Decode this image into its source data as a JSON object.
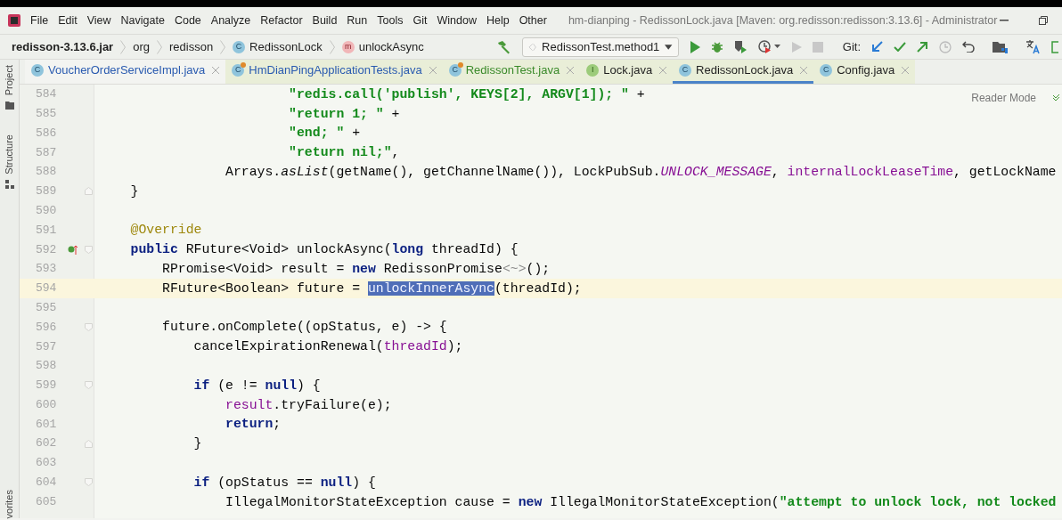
{
  "menu": [
    "File",
    "Edit",
    "View",
    "Navigate",
    "Code",
    "Analyze",
    "Refactor",
    "Build",
    "Run",
    "Tools",
    "Git",
    "Window",
    "Help",
    "Other"
  ],
  "window": {
    "title": "hm-dianping - RedissonLock.java [Maven: org.redisson:redisson:3.13.6] - Administrator"
  },
  "breadcrumb": [
    {
      "label": "redisson-3.13.6.jar",
      "kind": "jar"
    },
    {
      "label": "org",
      "kind": "package"
    },
    {
      "label": "redisson",
      "kind": "package"
    },
    {
      "label": "RedissonLock",
      "kind": "class",
      "icon_letter": "C"
    },
    {
      "label": "unlockAsync",
      "kind": "method",
      "icon_letter": "m"
    }
  ],
  "run_config": {
    "label": "RedissonTest.method1"
  },
  "git_label": "Git:",
  "tabs": [
    {
      "label": "VoucherOrderServiceImpl.java",
      "icon_letter": "C",
      "kind": "class",
      "color": "#2a5bb0",
      "tinted": false,
      "selected": false
    },
    {
      "label": "HmDianPingApplicationTests.java",
      "icon_letter": "C",
      "kind": "test",
      "color": "#2a5bb0",
      "tinted": true,
      "selected": false
    },
    {
      "label": "RedissonTest.java",
      "icon_letter": "C",
      "kind": "test",
      "color": "#3a8a2a",
      "tinted": true,
      "selected": false
    },
    {
      "label": "Lock.java",
      "icon_letter": "I",
      "kind": "interface",
      "color": "#1f1f1f",
      "tinted": true,
      "selected": false
    },
    {
      "label": "RedissonLock.java",
      "icon_letter": "C",
      "kind": "class",
      "color": "#1f1f1f",
      "tinted": true,
      "selected": true
    },
    {
      "label": "Config.java",
      "icon_letter": "C",
      "kind": "class",
      "color": "#1f1f1f",
      "tinted": true,
      "selected": false
    }
  ],
  "side_panels": [
    {
      "label": "Project"
    },
    {
      "label": "Structure"
    },
    {
      "label": "vorites"
    }
  ],
  "reader_mode": "Reader Mode",
  "lines": [
    {
      "number": "584",
      "tokens": [
        {
          "text": "                        \"redis.call('publish', KEYS[2], ARGV[1]); \"",
          "kind": "string"
        },
        {
          "text": " +",
          "kind": "plain"
        }
      ]
    },
    {
      "number": "585",
      "tokens": [
        {
          "text": "                        \"return 1; \"",
          "kind": "string"
        },
        {
          "text": " +",
          "kind": "plain"
        }
      ]
    },
    {
      "number": "586",
      "tokens": [
        {
          "text": "                        \"end; \"",
          "kind": "string"
        },
        {
          "text": " +",
          "kind": "plain"
        }
      ]
    },
    {
      "number": "587",
      "tokens": [
        {
          "text": "                        \"return nil;\"",
          "kind": "string"
        },
        {
          "text": ",",
          "kind": "plain"
        }
      ]
    },
    {
      "number": "588",
      "tokens": [
        {
          "text": "                Arrays.",
          "kind": "plain"
        },
        {
          "text": "asList",
          "kind": "static_method"
        },
        {
          "text": "(getName(), getChannelName()), LockPubSub.",
          "kind": "plain"
        },
        {
          "text": "UNLOCK_MESSAGE",
          "kind": "static_field"
        },
        {
          "text": ", ",
          "kind": "plain"
        },
        {
          "text": "internalLockLeaseTime",
          "kind": "field"
        },
        {
          "text": ", getLockName",
          "kind": "plain"
        }
      ]
    },
    {
      "number": "589",
      "fold_marker": {
        "kind": "end"
      },
      "tokens": [
        {
          "text": "    }",
          "kind": "plain"
        }
      ]
    },
    {
      "number": "590"
    },
    {
      "number": "591",
      "tokens": [
        {
          "text": "    @Override",
          "kind": "annotation"
        }
      ]
    },
    {
      "number": "592",
      "fold_marker": {
        "kind": "start"
      },
      "override_marker": true,
      "tokens": [
        {
          "text": "    public",
          "kind": "keyword"
        },
        {
          "text": " RFuture<Void> unlockAsync(",
          "kind": "plain"
        },
        {
          "text": "long",
          "kind": "keyword"
        },
        {
          "text": " threadId) {",
          "kind": "plain"
        }
      ]
    },
    {
      "number": "593",
      "tokens": [
        {
          "text": "        RPromise<Void> result = ",
          "kind": "plain"
        },
        {
          "text": "new",
          "kind": "keyword"
        },
        {
          "text": " RedissonPromise",
          "kind": "plain"
        },
        {
          "text": "<~>",
          "kind": "folded"
        },
        {
          "text": "();",
          "kind": "plain"
        }
      ]
    },
    {
      "number": "594",
      "current": true,
      "tokens": [
        {
          "text": "        RFuture<Boolean> future = ",
          "kind": "plain"
        },
        {
          "text": "unlockInnerAsync",
          "kind": "selected"
        },
        {
          "text": "(threadId);",
          "kind": "plain"
        }
      ]
    },
    {
      "number": "595"
    },
    {
      "number": "596",
      "fold_marker": {
        "kind": "start"
      },
      "tokens": [
        {
          "text": "        future.onComplete((opStatus, e) -> {",
          "kind": "plain"
        }
      ]
    },
    {
      "number": "597",
      "tokens": [
        {
          "text": "            cancelExpirationRenewal(",
          "kind": "plain"
        },
        {
          "text": "threadId",
          "kind": "field"
        },
        {
          "text": ");",
          "kind": "plain"
        }
      ]
    },
    {
      "number": "598"
    },
    {
      "number": "599",
      "fold_marker": {
        "kind": "start"
      },
      "tokens": [
        {
          "text": "            if",
          "kind": "keyword"
        },
        {
          "text": " (e != ",
          "kind": "plain"
        },
        {
          "text": "null",
          "kind": "keyword"
        },
        {
          "text": ") {",
          "kind": "plain"
        }
      ]
    },
    {
      "number": "600",
      "tokens": [
        {
          "text": "                result",
          "kind": "field"
        },
        {
          "text": ".tryFailure(e);",
          "kind": "plain"
        }
      ]
    },
    {
      "number": "601",
      "tokens": [
        {
          "text": "                return",
          "kind": "keyword"
        },
        {
          "text": ";",
          "kind": "plain"
        }
      ]
    },
    {
      "number": "602",
      "fold_marker": {
        "kind": "end"
      },
      "tokens": [
        {
          "text": "            }",
          "kind": "plain"
        }
      ]
    },
    {
      "number": "603"
    },
    {
      "number": "604",
      "fold_marker": {
        "kind": "start"
      },
      "tokens": [
        {
          "text": "            if",
          "kind": "keyword"
        },
        {
          "text": " (opStatus == ",
          "kind": "plain"
        },
        {
          "text": "null",
          "kind": "keyword"
        },
        {
          "text": ") {",
          "kind": "plain"
        }
      ]
    },
    {
      "number": "605",
      "tokens": [
        {
          "text": "                IllegalMonitorStateException cause = ",
          "kind": "plain"
        },
        {
          "text": "new",
          "kind": "keyword"
        },
        {
          "text": " IllegalMonitorStateException(",
          "kind": "plain"
        },
        {
          "text": "\"attempt to unlock lock, not locked",
          "kind": "string"
        }
      ]
    }
  ]
}
